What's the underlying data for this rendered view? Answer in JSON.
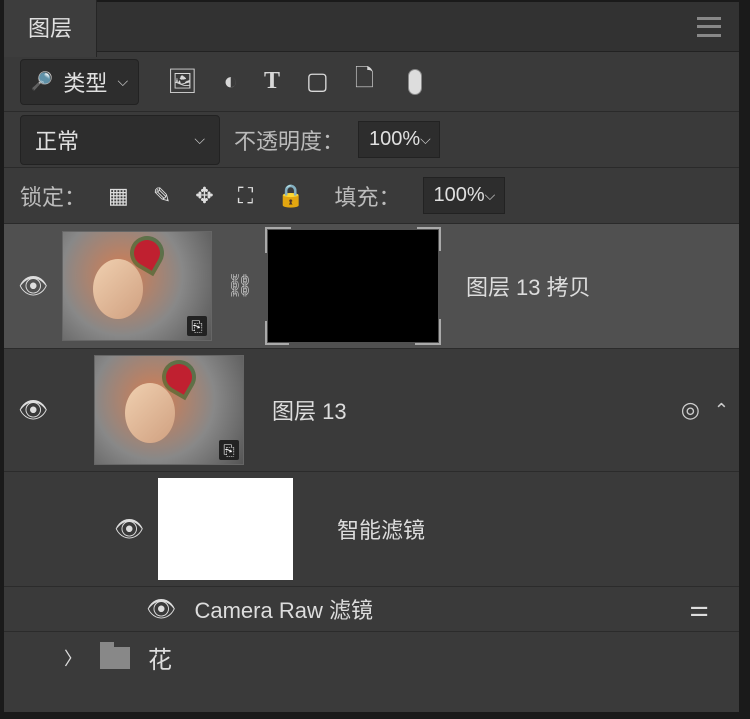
{
  "tab": {
    "title": "图层"
  },
  "filter": {
    "label": "类型"
  },
  "blend": {
    "mode": "正常",
    "opacity_label": "不透明度：",
    "opacity_value": "100%"
  },
  "lock": {
    "label": "锁定：",
    "fill_label": "填充：",
    "fill_value": "100%"
  },
  "layers": [
    {
      "name": "图层 13 拷贝",
      "selected": true,
      "has_mask": true
    },
    {
      "name": "图层 13",
      "selected": false,
      "has_mask": false
    }
  ],
  "smart_filters": {
    "label": "智能滤镜",
    "entries": [
      "Camera Raw 滤镜"
    ]
  },
  "groups": [
    "花"
  ]
}
